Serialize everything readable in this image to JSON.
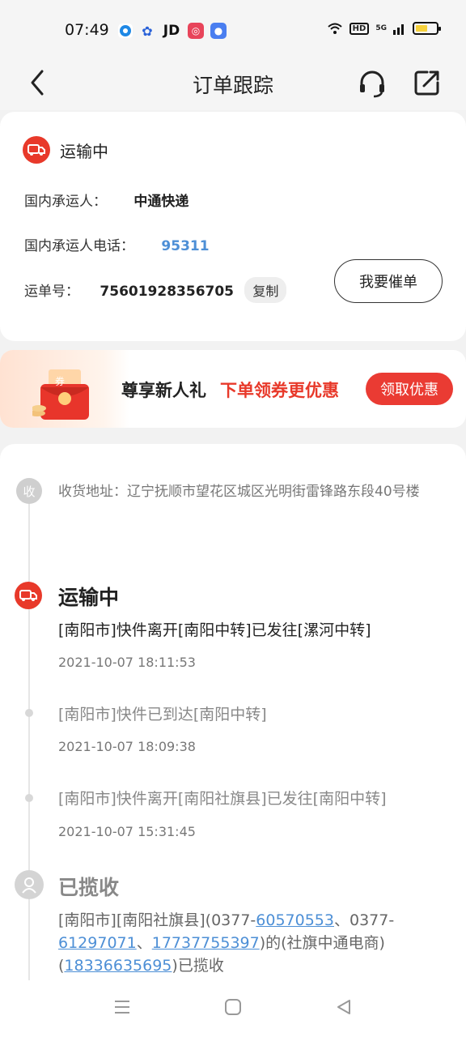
{
  "status_bar": {
    "time": "07:49",
    "jd": "JD",
    "net": "5G",
    "hd": "HD"
  },
  "nav": {
    "title": "订单跟踪"
  },
  "shipment": {
    "status": "运输中",
    "carrier_label": "国内承运人：",
    "carrier": "中通快递",
    "phone_label": "国内承运人电话：",
    "phone": "95311",
    "waybill_label": "运单号：",
    "waybill": "75601928356705",
    "copy_label": "复制",
    "urge_label": "我要催单"
  },
  "banner": {
    "text1": "尊享新人礼",
    "text2": "下单领券更优惠",
    "button": "领取优惠",
    "coupon_char": "券"
  },
  "tracking": {
    "receive_icon": "收",
    "address": "收货地址：辽宁抚顺市望花区城区光明街雷锋路东段40号楼",
    "current_status": "运输中",
    "events": [
      {
        "text": "[南阳市]快件离开[南阳中转]已发往[漯河中转]",
        "time": "2021-10-07 18:11:53"
      },
      {
        "text": "[南阳市]快件已到达[南阳中转]",
        "time": "2021-10-07 18:09:38"
      },
      {
        "text": "[南阳市]快件离开[南阳社旗县]已发往[南阳中转]",
        "time": "2021-10-07 15:31:45"
      }
    ],
    "collected_status": "已揽收",
    "collected": {
      "p1": "[南阳市][南阳社旗县](0377-",
      "link1": "60570553",
      "p2": "、0377-",
      "link2": "61297071",
      "p3": "、",
      "link3": "17737755397",
      "p4": ")的(社旗中通电商)(",
      "link4": "18336635695",
      "p5": ")已揽收"
    }
  },
  "colors": {
    "accent_red": "#e8392a",
    "link_blue": "#4d8fd6"
  },
  "icons": [
    "back-icon",
    "headset-icon",
    "share-icon",
    "truck-icon",
    "courier-icon",
    "menu-icon",
    "home-icon",
    "back-triangle-icon"
  ]
}
